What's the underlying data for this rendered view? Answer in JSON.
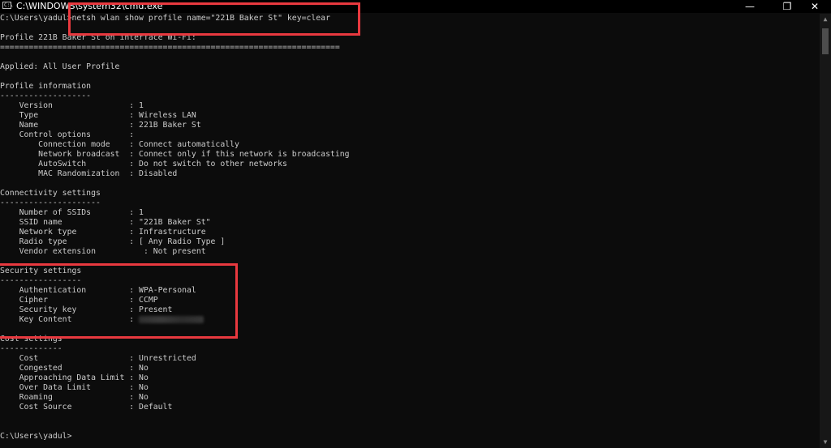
{
  "window": {
    "title": "C:\\WINDOWS\\system32\\cmd.exe",
    "icon_label": "C:\\",
    "minimize_glyph": "—",
    "maximize_glyph": "❐",
    "close_glyph": "✕"
  },
  "console": {
    "lines": [
      "C:\\Users\\yadul>netsh wlan show profile name=\"221B Baker St\" key=clear",
      "",
      "Profile 221B Baker St on interface Wi-Fi:",
      "=======================================================================",
      "",
      "Applied: All User Profile",
      "",
      "Profile information",
      "-------------------",
      "    Version                : 1",
      "    Type                   : Wireless LAN",
      "    Name                   : 221B Baker St",
      "    Control options        :",
      "        Connection mode    : Connect automatically",
      "        Network broadcast  : Connect only if this network is broadcasting",
      "        AutoSwitch         : Do not switch to other networks",
      "        MAC Randomization  : Disabled",
      "",
      "Connectivity settings",
      "---------------------",
      "    Number of SSIDs        : 1",
      "    SSID name              : \"221B Baker St\"",
      "    Network type           : Infrastructure",
      "    Radio type             : [ Any Radio Type ]",
      "    Vendor extension          : Not present",
      "",
      "Security settings",
      "-----------------",
      "    Authentication         : WPA-Personal",
      "    Cipher                 : CCMP",
      "    Security key           : Present",
      "    Key Content            : ",
      "",
      "Cost settings",
      "-------------",
      "    Cost                   : Unrestricted",
      "    Congested              : No",
      "    Approaching Data Limit : No",
      "    Over Data Limit        : No",
      "    Roaming                : No",
      "    Cost Source            : Default",
      "",
      "",
      "C:\\Users\\yadul>"
    ],
    "redacted_line_index": 31
  },
  "colors": {
    "background": "#0c0c0c",
    "text": "#cccccc",
    "highlight": "#e8393f"
  },
  "icons": [
    "cmd-app-icon",
    "minimize-icon",
    "maximize-icon",
    "close-icon"
  ]
}
